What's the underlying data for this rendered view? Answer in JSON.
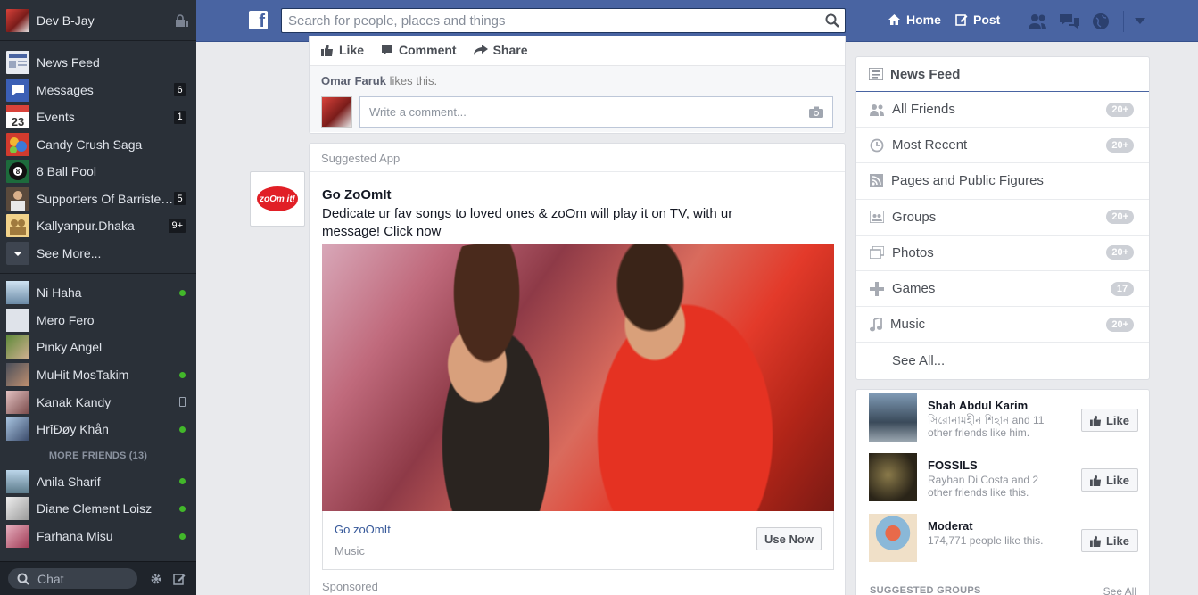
{
  "user": {
    "name": "Dev B-Jay"
  },
  "sidebar": {
    "apps": [
      {
        "label": "News Feed",
        "count": "",
        "icon": "newsfeed-icon"
      },
      {
        "label": "Messages",
        "count": "6",
        "icon": "messages-icon"
      },
      {
        "label": "Events",
        "count": "1",
        "icon": "events-icon"
      },
      {
        "label": "Candy Crush Saga",
        "count": "",
        "icon": "candy-crush-icon"
      },
      {
        "label": "8 Ball Pool",
        "count": "",
        "icon": "8-ball-pool-icon"
      },
      {
        "label": "Supporters Of Barrister...",
        "count": "5",
        "icon": "group-icon"
      },
      {
        "label": "Kallyanpur.Dhaka",
        "count": "9+",
        "icon": "group-icon"
      },
      {
        "label": "See More...",
        "count": "",
        "icon": "chevron-down-icon"
      }
    ],
    "events_day": "23",
    "friends": [
      {
        "name": "Ni Haha",
        "status": "online"
      },
      {
        "name": "Mero Fero",
        "status": ""
      },
      {
        "name": "Pinky Angel",
        "status": ""
      },
      {
        "name": "MuHit MosTakim",
        "status": "online"
      },
      {
        "name": "Kanak Kandy",
        "status": "mobile"
      },
      {
        "name": "HrîĐøy Khån",
        "status": "online"
      }
    ],
    "more_friends_label": "MORE FRIENDS (13)",
    "more_friends": [
      {
        "name": "Anila Sharif",
        "status": "online"
      },
      {
        "name": "Diane Clement Loisz",
        "status": "online"
      },
      {
        "name": "Farhana Misu",
        "status": "online"
      }
    ],
    "chat_placeholder": "Chat"
  },
  "topbar": {
    "logo": "f",
    "search_placeholder": "Search for people, places and things",
    "home_label": "Home",
    "post_label": "Post"
  },
  "prev_post": {
    "like_label": "Like",
    "comment_label": "Comment",
    "share_label": "Share",
    "liker": "Omar Faruk",
    "likes_suffix": " likes this.",
    "comment_placeholder": "Write a comment..."
  },
  "suggested": {
    "header": "Suggested App",
    "app_logo_text": "zoOm it!",
    "title": "Go ZoOmIt",
    "description": "Dedicate ur fav songs to loved ones & zoOm will play it on TV, with ur message! Click now",
    "footer_name": "Go zoOmIt",
    "footer_category": "Music",
    "cta": "Use Now",
    "sponsored": "Sponsored"
  },
  "newsfeed_panel": {
    "title": "News Feed",
    "items": [
      {
        "label": "All Friends",
        "badge": "20+",
        "icon": "friends-icon"
      },
      {
        "label": "Most Recent",
        "badge": "20+",
        "icon": "clock-icon"
      },
      {
        "label": "Pages and Public Figures",
        "badge": "",
        "icon": "rss-icon"
      },
      {
        "label": "Groups",
        "badge": "20+",
        "icon": "groups-icon"
      },
      {
        "label": "Photos",
        "badge": "20+",
        "icon": "photos-icon"
      },
      {
        "label": "Games",
        "badge": "17",
        "icon": "games-icon"
      },
      {
        "label": "Music",
        "badge": "20+",
        "icon": "music-icon"
      }
    ],
    "see_all": "See All..."
  },
  "suggested_pages": [
    {
      "name": "Shah Abdul Karim",
      "sub": "সিরোনামহীন শিহান and 11 other friends like him."
    },
    {
      "name": "FOSSILS",
      "sub": "Rayhan Di Costa and 2 other friends like this."
    },
    {
      "name": "Moderat",
      "sub": "174,771 people like this."
    }
  ],
  "like_label": "Like",
  "suggested_groups": {
    "title": "SUGGESTED GROUPS",
    "see_all": "See All"
  },
  "colors": {
    "brand": "#4964a2",
    "sidebar": "#2a3038",
    "online": "#42b72a",
    "link": "#365899"
  }
}
